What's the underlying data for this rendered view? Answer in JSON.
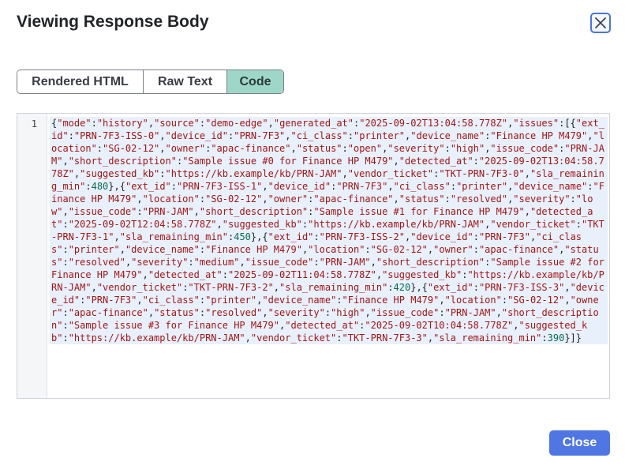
{
  "dialog": {
    "title": "Viewing Response Body",
    "close_icon": "close-x-icon"
  },
  "tabs": [
    {
      "label": "Rendered HTML",
      "active": false
    },
    {
      "label": "Raw Text",
      "active": false
    },
    {
      "label": "Code",
      "active": true
    }
  ],
  "editor": {
    "line_number": "1",
    "code": "{\"mode\":\"history\",\"source\":\"demo-edge\",\"generated_at\":\"2025-09-02T13:04:58.778Z\",\"issues\":[{\"ext_id\":\"PRN-7F3-ISS-0\",\"device_id\":\"PRN-7F3\",\"ci_class\":\"printer\",\"device_name\":\"Finance HP M479\",\"location\":\"SG-02-12\",\"owner\":\"apac-finance\",\"status\":\"open\",\"severity\":\"high\",\"issue_code\":\"PRN-JAM\",\"short_description\":\"Sample issue #0 for Finance HP M479\",\"detected_at\":\"2025-09-02T13:04:58.778Z\",\"suggested_kb\":\"https://kb.example/kb/PRN-JAM\",\"vendor_ticket\":\"TKT-PRN-7F3-0\",\"sla_remaining_min\":480},{\"ext_id\":\"PRN-7F3-ISS-1\",\"device_id\":\"PRN-7F3\",\"ci_class\":\"printer\",\"device_name\":\"Finance HP M479\",\"location\":\"SG-02-12\",\"owner\":\"apac-finance\",\"status\":\"resolved\",\"severity\":\"low\",\"issue_code\":\"PRN-JAM\",\"short_description\":\"Sample issue #1 for Finance HP M479\",\"detected_at\":\"2025-09-02T12:04:58.778Z\",\"suggested_kb\":\"https://kb.example/kb/PRN-JAM\",\"vendor_ticket\":\"TKT-PRN-7F3-1\",\"sla_remaining_min\":450},{\"ext_id\":\"PRN-7F3-ISS-2\",\"device_id\":\"PRN-7F3\",\"ci_class\":\"printer\",\"device_name\":\"Finance HP M479\",\"location\":\"SG-02-12\",\"owner\":\"apac-finance\",\"status\":\"resolved\",\"severity\":\"medium\",\"issue_code\":\"PRN-JAM\",\"short_description\":\"Sample issue #2 for Finance HP M479\",\"detected_at\":\"2025-09-02T11:04:58.778Z\",\"suggested_kb\":\"https://kb.example/kb/PRN-JAM\",\"vendor_ticket\":\"TKT-PRN-7F3-2\",\"sla_remaining_min\":420},{\"ext_id\":\"PRN-7F3-ISS-3\",\"device_id\":\"PRN-7F3\",\"ci_class\":\"printer\",\"device_name\":\"Finance HP M479\",\"location\":\"SG-02-12\",\"owner\":\"apac-finance\",\"status\":\"resolved\",\"severity\":\"high\",\"issue_code\":\"PRN-JAM\",\"short_description\":\"Sample issue #3 for Finance HP M479\",\"detected_at\":\"2025-09-02T10:04:58.778Z\",\"suggested_kb\":\"https://kb.example/kb/PRN-JAM\",\"vendor_ticket\":\"TKT-PRN-7F3-3\",\"sla_remaining_min\":390}]}"
  },
  "footer": {
    "close_label": "Close"
  },
  "colors": {
    "accent": "#4f76e2",
    "active_tab": "#9ed7c7",
    "string_token": "#a31515",
    "number_token": "#0b6b4f"
  }
}
